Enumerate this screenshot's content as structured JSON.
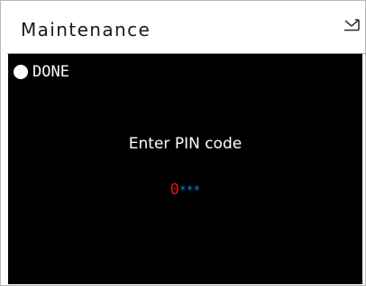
{
  "header": {
    "title": "Maintenance",
    "icon": "envelope-icon"
  },
  "status": {
    "indicator": "white-dot",
    "text": "DONE"
  },
  "prompt": {
    "text": "Enter PIN code"
  },
  "pin": {
    "active_digit": "0",
    "masked": "***",
    "active_color": "#e8101a",
    "mask_color": "#1a7fe0"
  },
  "colors": {
    "screen_background": "#000000",
    "header_background": "#ffffff"
  }
}
